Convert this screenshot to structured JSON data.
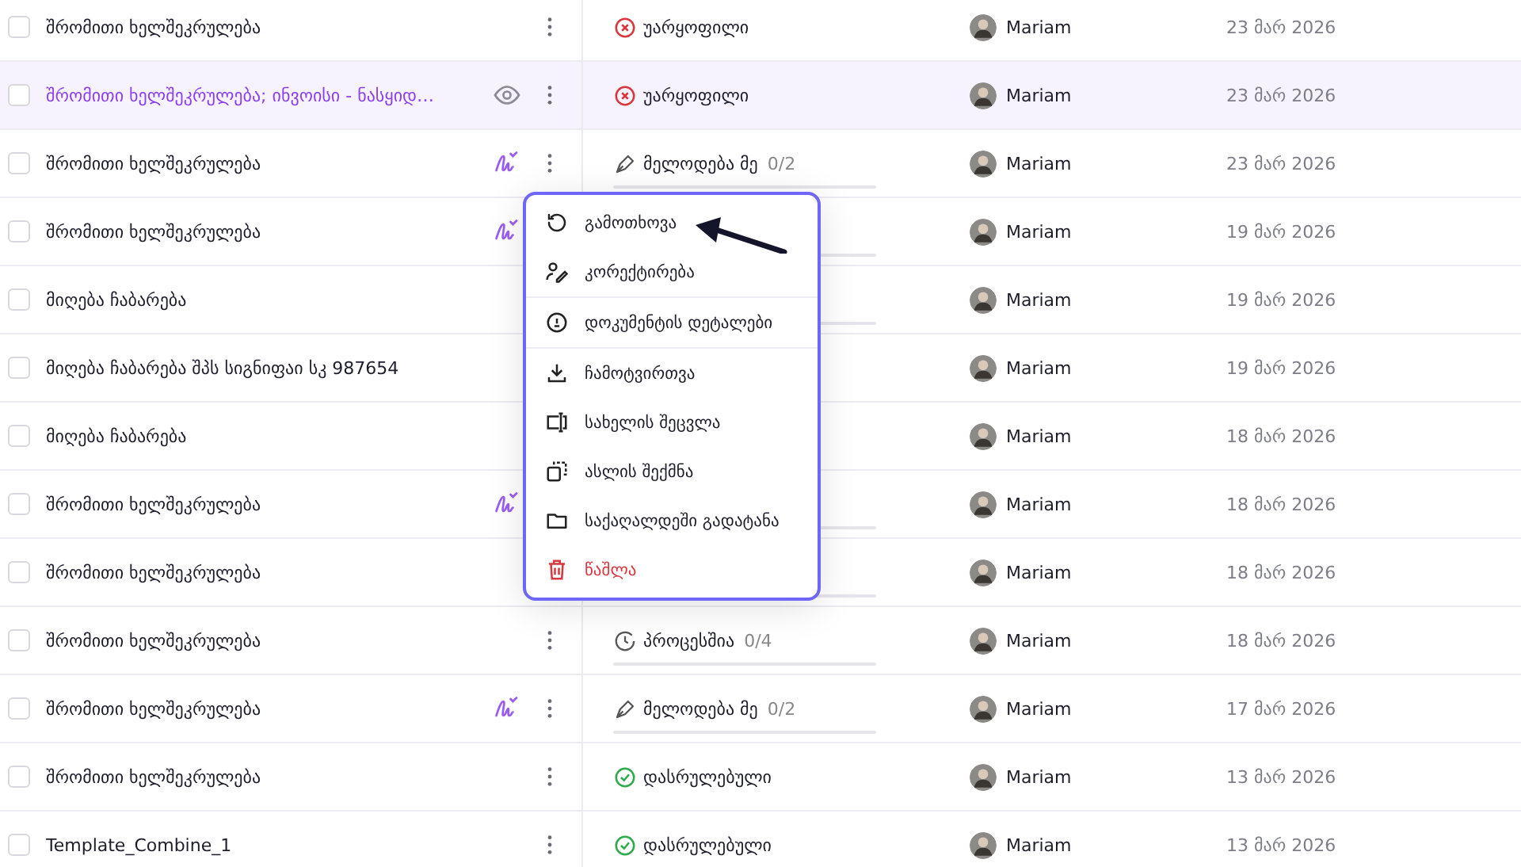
{
  "rows": [
    {
      "title": "შრომითი ხელშეკრულება",
      "selected": false,
      "actions": [
        {
          "kind": "more"
        }
      ],
      "status": {
        "kind": "rejected",
        "label": "უარყოფილი"
      },
      "owner": "Mariam",
      "date": "23 მარ 2026"
    },
    {
      "title": "შრომითი ხელშეკრულება; ინვოისი - ნასყიდ…",
      "selected": true,
      "actions": [
        {
          "kind": "view"
        },
        {
          "kind": "more"
        }
      ],
      "status": {
        "kind": "rejected",
        "label": "უარყოფილი"
      },
      "owner": "Mariam",
      "date": "23 მარ 2026"
    },
    {
      "title": "შრომითი ხელშეკრულება",
      "selected": false,
      "actions": [
        {
          "kind": "sign"
        },
        {
          "kind": "more"
        }
      ],
      "status": {
        "kind": "waiting",
        "label": "მელოდება მე",
        "count": "0/2"
      },
      "owner": "Mariam",
      "date": "23 მარ 2026"
    },
    {
      "title": "შრომითი ხელშეკრულება",
      "selected": false,
      "actions": [
        {
          "kind": "sign"
        }
      ],
      "status": {
        "kind": "covered"
      },
      "owner": "Mariam",
      "date": "19 მარ 2026"
    },
    {
      "title": "მიღება ჩაბარება",
      "selected": false,
      "status": {
        "kind": "covered"
      },
      "owner": "Mariam",
      "date": "19 მარ 2026"
    },
    {
      "title": "მიღება ჩაბარება შპს სიგნიფაი სკ 987654",
      "selected": false,
      "owner": "Mariam",
      "date": "19 მარ 2026"
    },
    {
      "title": "მიღება ჩაბარება",
      "selected": false,
      "owner": "Mariam",
      "date": "18 მარ 2026"
    },
    {
      "title": "შრომითი ხელშეკრულება",
      "selected": false,
      "actions": [
        {
          "kind": "sign"
        }
      ],
      "status": {
        "kind": "covered"
      },
      "owner": "Mariam",
      "date": "18 მარ 2026"
    },
    {
      "title": "შრომითი ხელშეკრულება",
      "selected": false,
      "status": {
        "kind": "covered"
      },
      "owner": "Mariam",
      "date": "18 მარ 2026"
    },
    {
      "title": "შრომითი ხელშეკრულება",
      "selected": false,
      "actions": [
        {
          "kind": "more"
        }
      ],
      "status": {
        "kind": "progress",
        "label": "პროცესშია",
        "count": "0/4"
      },
      "owner": "Mariam",
      "date": "18 მარ 2026"
    },
    {
      "title": "შრომითი ხელშეკრულება",
      "selected": false,
      "actions": [
        {
          "kind": "sign"
        },
        {
          "kind": "more"
        }
      ],
      "status": {
        "kind": "waiting",
        "label": "მელოდება მე",
        "count": "0/2"
      },
      "owner": "Mariam",
      "date": "17 მარ 2026"
    },
    {
      "title": "შრომითი ხელშეკრულება",
      "selected": false,
      "actions": [
        {
          "kind": "more"
        }
      ],
      "status": {
        "kind": "done",
        "label": "დასრულებული"
      },
      "owner": "Mariam",
      "date": "13 მარ 2026"
    },
    {
      "title": "Template_Combine_1",
      "selected": false,
      "actions": [
        {
          "kind": "more"
        }
      ],
      "status": {
        "kind": "done",
        "label": "დასრულებული"
      },
      "owner": "Mariam",
      "date": "13 მარ 2026"
    }
  ],
  "context_menu": {
    "groups": [
      [
        {
          "label": "გამოთხოვა",
          "danger": false
        },
        {
          "label": "კორექტირება",
          "danger": false
        }
      ],
      [
        {
          "label": "დოკუმენტის დეტალები",
          "danger": false
        }
      ],
      [
        {
          "label": "ჩამოტვირთვა",
          "danger": false
        },
        {
          "label": "სახელის შეცვლა",
          "danger": false
        },
        {
          "label": "ასლის შექმნა",
          "danger": false
        },
        {
          "label": "საქაღალდეში გადატანა",
          "danger": false
        },
        {
          "label": "წაშლა",
          "danger": true
        }
      ]
    ]
  },
  "annotation": {
    "kind": "arrow"
  }
}
